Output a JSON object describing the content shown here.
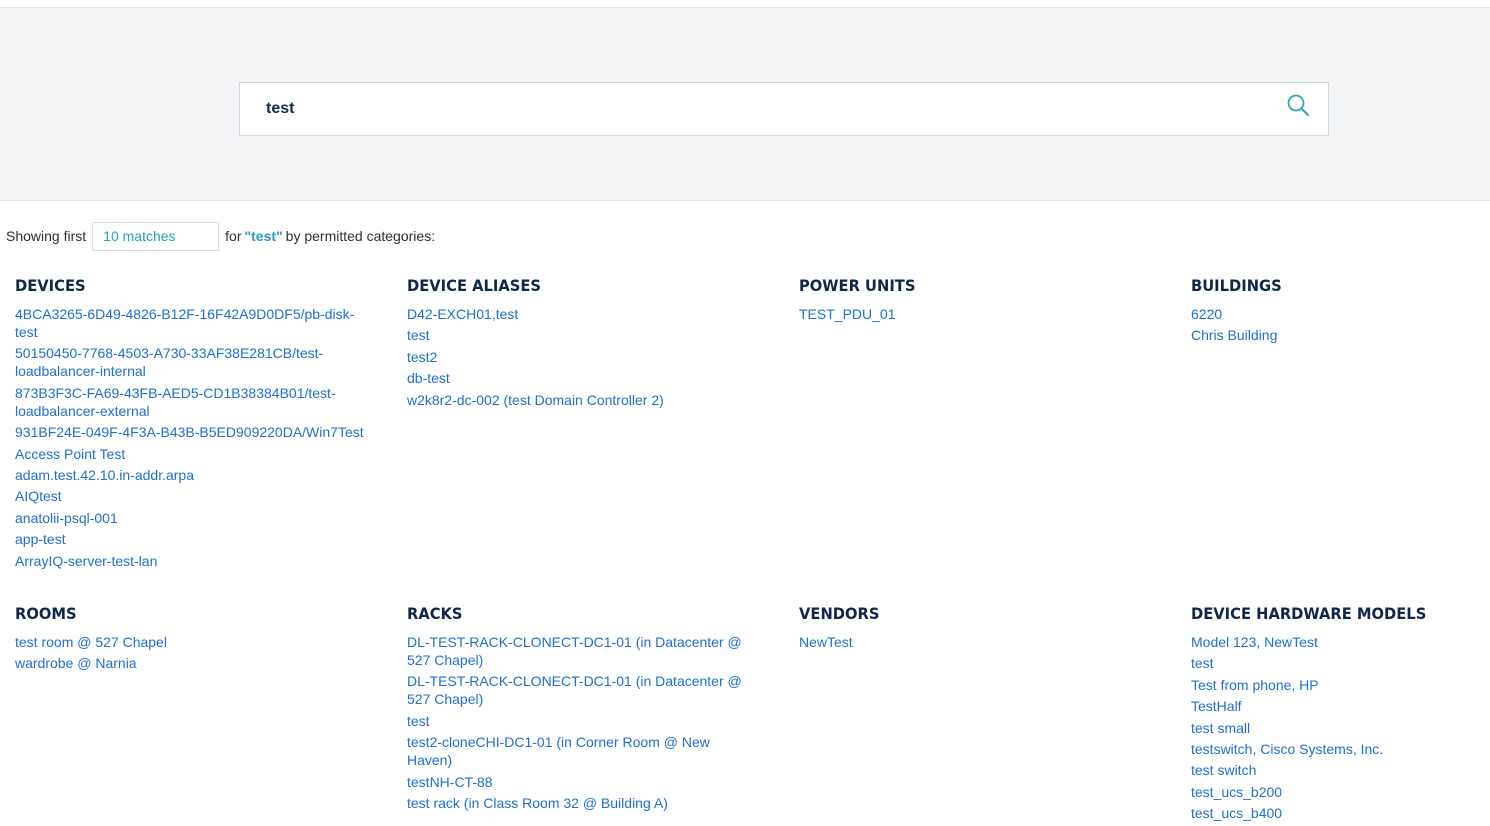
{
  "search": {
    "value": "test"
  },
  "summary": {
    "prefix": "Showing first",
    "count_selected": "10 matches",
    "for_label": "for",
    "query_display": "\"test\"",
    "suffix": "by permitted categories:"
  },
  "categories": [
    {
      "title": "DEVICES",
      "items": [
        "4BCA3265-6D49-4826-B12F-16F42A9D0DF5/pb-disk-test",
        "50150450-7768-4503-A730-33AF38E281CB/test-loadbalancer-internal",
        "873B3F3C-FA69-43FB-AED5-CD1B38384B01/test-loadbalancer-external",
        "931BF24E-049F-4F3A-B43B-B5ED909220DA/Win7Test",
        "Access Point Test",
        "adam.test.42.10.in-addr.arpa",
        "AIQtest",
        "anatolii-psql-001",
        "app-test",
        "ArrayIQ-server-test-lan"
      ]
    },
    {
      "title": "DEVICE ALIASES",
      "items": [
        "D42-EXCH01,test",
        "test",
        "test2",
        "db-test",
        "w2k8r2-dc-002 (test Domain Controller 2)"
      ]
    },
    {
      "title": "POWER UNITS",
      "items": [
        "TEST_PDU_01"
      ]
    },
    {
      "title": "BUILDINGS",
      "items": [
        "6220",
        "Chris Building"
      ]
    },
    {
      "title": "ROOMS",
      "items": [
        "test room @ 527 Chapel",
        "wardrobe @ Narnia"
      ]
    },
    {
      "title": "RACKS",
      "items": [
        "DL-TEST-RACK-CLONECT-DC1-01 (in Datacenter @ 527 Chapel)",
        "DL-TEST-RACK-CLONECT-DC1-01 (in Datacenter @ 527 Chapel)",
        "test",
        "test2-cloneCHI-DC1-01 (in Corner Room @ New Haven)",
        "testNH-CT-88",
        "test rack (in Class Room 32 @ Building A)"
      ]
    },
    {
      "title": "VENDORS",
      "items": [
        "NewTest"
      ]
    },
    {
      "title": "DEVICE HARDWARE MODELS",
      "items": [
        "Model 123, NewTest",
        "test",
        "Test from phone, HP",
        "TestHalf",
        "test small",
        "testswitch, Cisco Systems, Inc.",
        "test switch",
        "test_ucs_b200",
        "test_ucs_b400"
      ]
    }
  ]
}
